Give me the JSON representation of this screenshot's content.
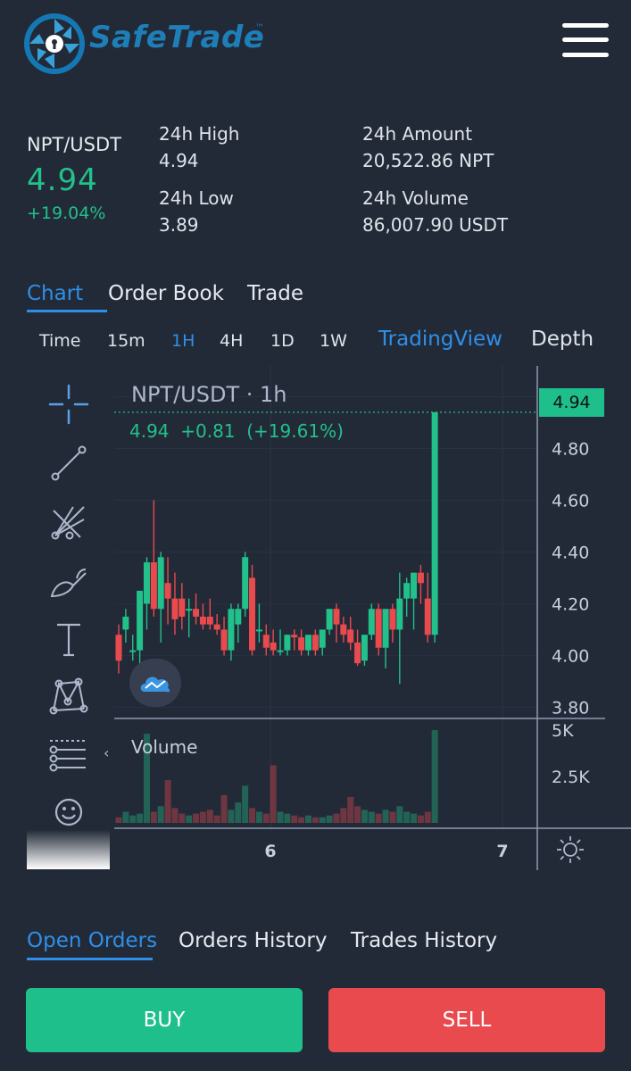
{
  "header": {
    "logo_text": "SafeTrade",
    "logo_tm": "™"
  },
  "ticker": {
    "pair": "NPT/USDT",
    "price": "4.94",
    "change": "+19.04%",
    "high_label": "24h High",
    "high_value": "4.94",
    "low_label": "24h Low",
    "low_value": "3.89",
    "amount_label": "24h Amount",
    "amount_value": "20,522.86 NPT",
    "volume_label": "24h Volume",
    "volume_value": "86,007.90 USDT"
  },
  "main_tabs": [
    {
      "label": "Chart",
      "active": true
    },
    {
      "label": "Order Book",
      "active": false
    },
    {
      "label": "Trade",
      "active": false
    }
  ],
  "timeframes": [
    {
      "label": "Time",
      "active": false
    },
    {
      "label": "15m",
      "active": false
    },
    {
      "label": "1H",
      "active": true
    },
    {
      "label": "4H",
      "active": false
    },
    {
      "label": "1D",
      "active": false
    },
    {
      "label": "1W",
      "active": false
    }
  ],
  "chart_modes": [
    {
      "label": "TradingView",
      "active": true
    },
    {
      "label": "Depth",
      "active": false
    }
  ],
  "chart_legend": {
    "title": "NPT/USDT · 1h",
    "values": "4.94  +0.81  (+19.61%)",
    "volume_label": "Volume",
    "last_price_tag": "4.94"
  },
  "colors": {
    "up": "#22c08a",
    "down": "#e94a4e",
    "accent": "#2f8fe8",
    "background": "#222a38"
  },
  "chart_data": {
    "type": "candlestick",
    "price_ticks": [
      "5.00",
      "4.80",
      "4.60",
      "4.40",
      "4.20",
      "4.00",
      "3.80"
    ],
    "volume_ticks": [
      "5K",
      "2.5K"
    ],
    "x_ticks": [
      "6",
      "7"
    ],
    "ylim": [
      3.76,
      5.05
    ],
    "volume_max": 5000,
    "candles": [
      {
        "o": 4.08,
        "h": 4.12,
        "l": 3.93,
        "c": 3.98,
        "v": 300
      },
      {
        "o": 4.1,
        "h": 4.18,
        "l": 4.05,
        "c": 4.15,
        "v": 600
      },
      {
        "o": 4.02,
        "h": 4.08,
        "l": 3.98,
        "c": 4.02,
        "v": 400
      },
      {
        "o": 4.02,
        "h": 4.25,
        "l": 3.95,
        "c": 4.25,
        "v": 500
      },
      {
        "o": 4.2,
        "h": 4.38,
        "l": 4.1,
        "c": 4.36,
        "v": 4800
      },
      {
        "o": 4.36,
        "h": 4.6,
        "l": 4.15,
        "c": 4.18,
        "v": 600
      },
      {
        "o": 4.18,
        "h": 4.4,
        "l": 4.05,
        "c": 4.38,
        "v": 900
      },
      {
        "o": 4.28,
        "h": 4.38,
        "l": 4.12,
        "c": 4.22,
        "v": 2300
      },
      {
        "o": 4.22,
        "h": 4.32,
        "l": 4.08,
        "c": 4.14,
        "v": 800
      },
      {
        "o": 4.22,
        "h": 4.28,
        "l": 4.1,
        "c": 4.15,
        "v": 500
      },
      {
        "o": 4.18,
        "h": 4.22,
        "l": 4.07,
        "c": 4.18,
        "v": 400
      },
      {
        "o": 4.18,
        "h": 4.24,
        "l": 4.12,
        "c": 4.15,
        "v": 500
      },
      {
        "o": 4.15,
        "h": 4.2,
        "l": 4.1,
        "c": 4.12,
        "v": 600
      },
      {
        "o": 4.15,
        "h": 4.22,
        "l": 4.1,
        "c": 4.12,
        "v": 700
      },
      {
        "o": 4.12,
        "h": 4.16,
        "l": 4.08,
        "c": 4.1,
        "v": 400
      },
      {
        "o": 4.1,
        "h": 4.15,
        "l": 4.0,
        "c": 4.02,
        "v": 1500
      },
      {
        "o": 4.02,
        "h": 4.2,
        "l": 3.98,
        "c": 4.18,
        "v": 700
      },
      {
        "o": 4.12,
        "h": 4.2,
        "l": 4.05,
        "c": 4.18,
        "v": 1100
      },
      {
        "o": 4.18,
        "h": 4.4,
        "l": 4.15,
        "c": 4.38,
        "v": 2000
      },
      {
        "o": 4.3,
        "h": 4.35,
        "l": 4.0,
        "c": 4.02,
        "v": 800
      },
      {
        "o": 4.1,
        "h": 4.2,
        "l": 4.05,
        "c": 4.1,
        "v": 600
      },
      {
        "o": 4.08,
        "h": 4.12,
        "l": 4.0,
        "c": 4.03,
        "v": 500
      },
      {
        "o": 4.05,
        "h": 4.1,
        "l": 4.0,
        "c": 4.02,
        "v": 3100
      },
      {
        "o": 4.02,
        "h": 4.1,
        "l": 4.0,
        "c": 4.02,
        "v": 600
      },
      {
        "o": 4.02,
        "h": 4.08,
        "l": 4.0,
        "c": 4.08,
        "v": 500
      },
      {
        "o": 4.08,
        "h": 4.1,
        "l": 4.02,
        "c": 4.07,
        "v": 400
      },
      {
        "o": 4.07,
        "h": 4.1,
        "l": 4.0,
        "c": 4.02,
        "v": 300
      },
      {
        "o": 4.02,
        "h": 4.08,
        "l": 4.0,
        "c": 4.08,
        "v": 400
      },
      {
        "o": 4.08,
        "h": 4.1,
        "l": 4.0,
        "c": 4.02,
        "v": 300
      },
      {
        "o": 4.03,
        "h": 4.1,
        "l": 4.0,
        "c": 4.1,
        "v": 300
      },
      {
        "o": 4.1,
        "h": 4.18,
        "l": 4.08,
        "c": 4.18,
        "v": 400
      },
      {
        "o": 4.18,
        "h": 4.2,
        "l": 4.05,
        "c": 4.12,
        "v": 500
      },
      {
        "o": 4.12,
        "h": 4.15,
        "l": 4.05,
        "c": 4.08,
        "v": 800
      },
      {
        "o": 4.1,
        "h": 4.15,
        "l": 4.02,
        "c": 4.05,
        "v": 1400
      },
      {
        "o": 4.05,
        "h": 4.1,
        "l": 3.96,
        "c": 3.97,
        "v": 900
      },
      {
        "o": 3.98,
        "h": 4.08,
        "l": 3.96,
        "c": 4.08,
        "v": 700
      },
      {
        "o": 4.08,
        "h": 4.2,
        "l": 4.06,
        "c": 4.18,
        "v": 600
      },
      {
        "o": 4.18,
        "h": 4.2,
        "l": 4.0,
        "c": 4.03,
        "v": 500
      },
      {
        "o": 4.03,
        "h": 4.15,
        "l": 3.95,
        "c": 4.18,
        "v": 700
      },
      {
        "o": 4.18,
        "h": 4.2,
        "l": 4.05,
        "c": 4.1,
        "v": 600
      },
      {
        "o": 4.1,
        "h": 4.32,
        "l": 3.89,
        "c": 4.22,
        "v": 900
      },
      {
        "o": 4.22,
        "h": 4.3,
        "l": 4.15,
        "c": 4.28,
        "v": 600
      },
      {
        "o": 4.22,
        "h": 4.32,
        "l": 4.1,
        "c": 4.32,
        "v": 500
      },
      {
        "o": 4.32,
        "h": 4.35,
        "l": 4.2,
        "c": 4.28,
        "v": 400
      },
      {
        "o": 4.22,
        "h": 4.32,
        "l": 4.05,
        "c": 4.08,
        "v": 600
      },
      {
        "o": 4.08,
        "h": 4.94,
        "l": 4.05,
        "c": 4.94,
        "v": 5000
      }
    ]
  },
  "bottom_tabs": [
    {
      "label": "Open Orders",
      "active": true
    },
    {
      "label": "Orders History",
      "active": false
    },
    {
      "label": "Trades History",
      "active": false
    }
  ],
  "actions": {
    "buy": "BUY",
    "sell": "SELL"
  }
}
